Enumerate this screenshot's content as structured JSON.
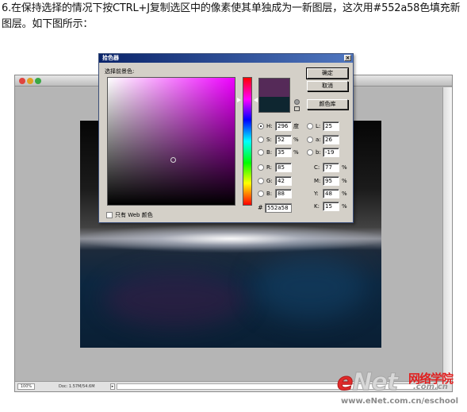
{
  "intro_text": "6.在保持选择的情况下按CTRL+J复制选区中的像素使其单独成为一新图层，这次用#552a58色填充新图层。如下图所示：",
  "document_window": {
    "zoom": "100%",
    "doc_info": "Doc: 1.57M/54.6M",
    "status_arrow": "▸"
  },
  "color_picker": {
    "title": "拾色器",
    "close_glyph": "×",
    "foreground_label": "选择前景色:",
    "buttons": {
      "ok": "确定",
      "cancel": "取消",
      "color_libraries": "颜色库"
    },
    "new_color": "#552a58",
    "current_color": "#0e2630",
    "hsb": [
      {
        "label": "H:",
        "value": "296",
        "unit": "度",
        "selected": true
      },
      {
        "label": "S:",
        "value": "52",
        "unit": "%",
        "selected": false
      },
      {
        "label": "B:",
        "value": "35",
        "unit": "%",
        "selected": false
      }
    ],
    "rgb": [
      {
        "label": "R:",
        "value": "85",
        "selected": false
      },
      {
        "label": "G:",
        "value": "42",
        "selected": false
      },
      {
        "label": "B:",
        "value": "88",
        "selected": false
      }
    ],
    "lab": [
      {
        "label": "L:",
        "value": "25",
        "selected": false
      },
      {
        "label": "a:",
        "value": "26",
        "selected": false
      },
      {
        "label": "b:",
        "value": "-19",
        "selected": false
      }
    ],
    "cmyk": [
      {
        "label": "C:",
        "value": "77",
        "unit": "%"
      },
      {
        "label": "M:",
        "value": "95",
        "unit": "%"
      },
      {
        "label": "Y:",
        "value": "48",
        "unit": "%"
      },
      {
        "label": "K:",
        "value": "15",
        "unit": "%"
      }
    ],
    "hex_label": "#",
    "hex_value": "552a58",
    "web_colors_label": "只有 Web 颜色",
    "web_colors_checked": false
  },
  "watermark": {
    "brand_e": "e",
    "brand_rest": "Net",
    "brand_cn": "网络学院",
    "brand_domain": ".com.cn",
    "url": "www.eNet.com.cn/eschool"
  }
}
